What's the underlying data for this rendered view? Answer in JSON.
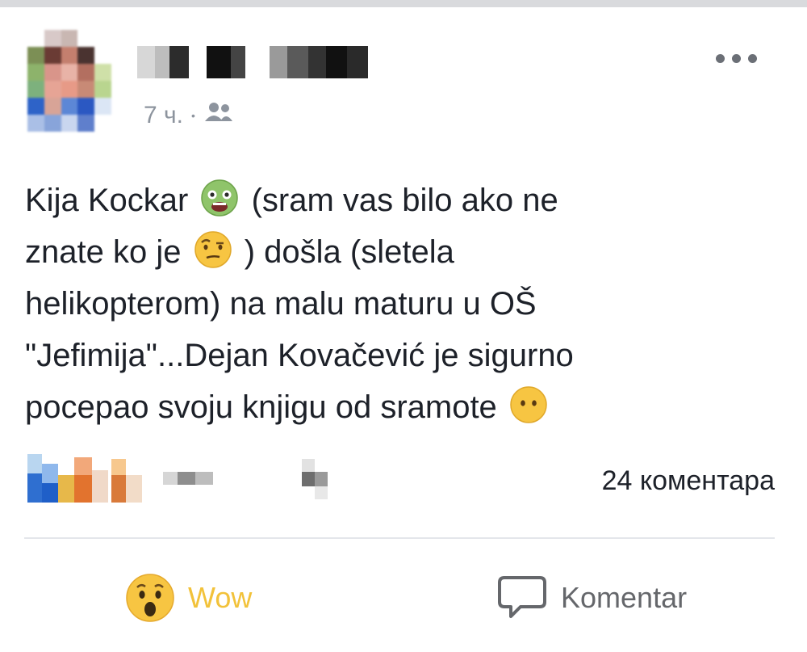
{
  "post": {
    "author_name": "",
    "time": "7 ч.",
    "separator": "•",
    "audience_icon": "friends-icon",
    "more_icon": "more-horizontal-icon",
    "text_lines": {
      "l1a": "Kija Kockar",
      "l1b": "(sram vas bilo ako ne",
      "l2a": "znate ko je",
      "l2b": ") došla (sletela",
      "l3": "helikopterom) na malu maturu u OŠ",
      "l4": "\"Jefimija\"...Dejan Kovačević je sigurno",
      "l5a": "pocepao svoju knjigu od sramote"
    },
    "emojis": [
      "nauseated-face-icon",
      "face-with-raised-eyebrow-icon",
      "face-without-mouth-icon"
    ]
  },
  "summary": {
    "comments_count": "24 коментара"
  },
  "actions": {
    "wow_label": "Wow",
    "wow_icon": "wow-reaction-icon",
    "comment_label": "Komentar",
    "comment_icon": "speech-bubble-icon"
  },
  "colors": {
    "text": "#1d2129",
    "muted": "#8d949e",
    "wow": "#f2c23a",
    "divider": "#e4e6eb"
  }
}
